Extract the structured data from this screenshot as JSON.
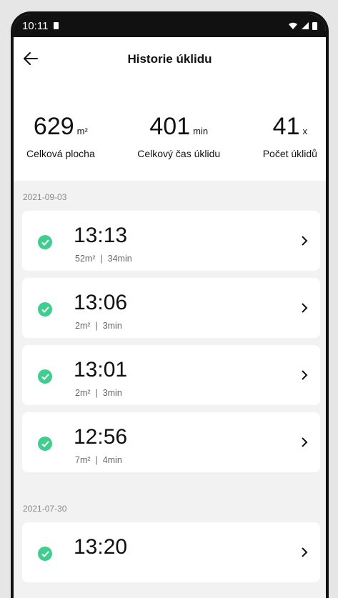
{
  "status_bar": {
    "time": "10:11"
  },
  "header": {
    "title": "Historie úklidu"
  },
  "stats": [
    {
      "value": "629",
      "unit": "m²",
      "label": "Celková plocha"
    },
    {
      "value": "401",
      "unit": "min",
      "label": "Celkový čas úklidu"
    },
    {
      "value": "41",
      "unit": "x",
      "label": "Počet úklidů"
    }
  ],
  "groups": [
    {
      "date": "2021-09-03",
      "items": [
        {
          "time": "13:13",
          "area": "52m²",
          "sep": "|",
          "duration": "34min"
        },
        {
          "time": "13:06",
          "area": "2m²",
          "sep": "|",
          "duration": "3min"
        },
        {
          "time": "13:01",
          "area": "2m²",
          "sep": "|",
          "duration": "3min"
        },
        {
          "time": "12:56",
          "area": "7m²",
          "sep": "|",
          "duration": "4min"
        }
      ]
    },
    {
      "date": "2021-07-30",
      "items": [
        {
          "time": "13:20"
        }
      ]
    }
  ],
  "colors": {
    "accent": "#3fce8f",
    "background": "#f2f2f2"
  }
}
